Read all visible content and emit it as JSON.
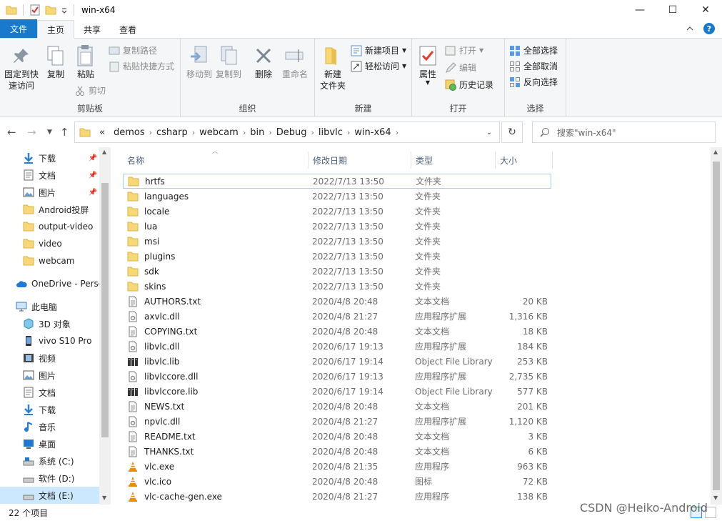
{
  "window": {
    "title": "win-x64",
    "minimize": "—",
    "maximize": "☐",
    "close": "✕"
  },
  "ribbon_tabs": [
    "文件",
    "主页",
    "共享",
    "查看"
  ],
  "ribbon": {
    "clipboard": {
      "label": "剪贴板",
      "pin": "固定到快速访问",
      "pin_l1": "固定到快",
      "pin_l2": "速访问",
      "copy": "复制",
      "paste": "粘贴",
      "copy_path": "复制路径",
      "paste_shortcut": "粘贴快捷方式",
      "cut": "剪切"
    },
    "organize": {
      "label": "组织",
      "move_to": "移动到",
      "copy_to": "复制到",
      "delete": "删除",
      "rename": "重命名"
    },
    "new": {
      "label": "新建",
      "new_folder_l1": "新建",
      "new_folder_l2": "文件夹",
      "new_item": "新建项目",
      "easy_access": "轻松访问"
    },
    "open": {
      "label": "打开",
      "properties": "属性",
      "open": "打开",
      "edit": "编辑",
      "history": "历史记录"
    },
    "select": {
      "label": "选择",
      "select_all": "全部选择",
      "select_none": "全部取消",
      "invert": "反向选择"
    }
  },
  "address": {
    "crumbs": [
      "«",
      "demos",
      "csharp",
      "webcam",
      "bin",
      "Debug",
      "libvlc",
      "win-x64"
    ],
    "search_placeholder": "搜索\"win-x64\""
  },
  "nav": [
    {
      "label": "下载",
      "icon": "download-icon",
      "pinned": true
    },
    {
      "label": "文档",
      "icon": "document-icon",
      "pinned": true
    },
    {
      "label": "图片",
      "icon": "picture-icon",
      "pinned": true
    },
    {
      "label": "Android投屏",
      "icon": "folder-icon"
    },
    {
      "label": "output-video",
      "icon": "folder-icon"
    },
    {
      "label": "video",
      "icon": "folder-icon"
    },
    {
      "label": "webcam",
      "icon": "folder-icon"
    },
    {
      "label": "OneDrive - Perso",
      "icon": "cloud-icon"
    },
    {
      "label": "此电脑",
      "icon": "computer-icon"
    },
    {
      "label": "3D 对象",
      "icon": "3d-objects-icon"
    },
    {
      "label": "vivo S10 Pro",
      "icon": "phone-icon"
    },
    {
      "label": "视频",
      "icon": "video-icon"
    },
    {
      "label": "图片",
      "icon": "picture-icon"
    },
    {
      "label": "文档",
      "icon": "document-icon"
    },
    {
      "label": "下载",
      "icon": "download-icon"
    },
    {
      "label": "音乐",
      "icon": "music-icon"
    },
    {
      "label": "桌面",
      "icon": "desktop-icon"
    },
    {
      "label": "系统 (C:)",
      "icon": "drive-icon"
    },
    {
      "label": "软件 (D:)",
      "icon": "drive-icon"
    },
    {
      "label": "文档 (E:)",
      "icon": "drive-icon",
      "selected": true
    }
  ],
  "columns": {
    "name": "名称",
    "date": "修改日期",
    "type": "类型",
    "size": "大小"
  },
  "files": [
    {
      "name": "hrtfs",
      "date": "2022/7/13 13:50",
      "type": "文件夹",
      "size": "",
      "icon": "folder-icon"
    },
    {
      "name": "languages",
      "date": "2022/7/13 13:50",
      "type": "文件夹",
      "size": "",
      "icon": "folder-icon"
    },
    {
      "name": "locale",
      "date": "2022/7/13 13:50",
      "type": "文件夹",
      "size": "",
      "icon": "folder-icon"
    },
    {
      "name": "lua",
      "date": "2022/7/13 13:50",
      "type": "文件夹",
      "size": "",
      "icon": "folder-icon"
    },
    {
      "name": "msi",
      "date": "2022/7/13 13:50",
      "type": "文件夹",
      "size": "",
      "icon": "folder-icon"
    },
    {
      "name": "plugins",
      "date": "2022/7/13 13:50",
      "type": "文件夹",
      "size": "",
      "icon": "folder-icon"
    },
    {
      "name": "sdk",
      "date": "2022/7/13 13:50",
      "type": "文件夹",
      "size": "",
      "icon": "folder-icon"
    },
    {
      "name": "skins",
      "date": "2022/7/13 13:50",
      "type": "文件夹",
      "size": "",
      "icon": "folder-icon"
    },
    {
      "name": "AUTHORS.txt",
      "date": "2020/4/8 20:48",
      "type": "文本文档",
      "size": "20 KB",
      "icon": "text-file-icon"
    },
    {
      "name": "axvlc.dll",
      "date": "2020/4/8 21:27",
      "type": "应用程序扩展",
      "size": "1,316 KB",
      "icon": "dll-icon"
    },
    {
      "name": "COPYING.txt",
      "date": "2020/4/8 20:48",
      "type": "文本文档",
      "size": "18 KB",
      "icon": "text-file-icon"
    },
    {
      "name": "libvlc.dll",
      "date": "2020/6/17 19:13",
      "type": "应用程序扩展",
      "size": "184 KB",
      "icon": "dll-icon"
    },
    {
      "name": "libvlc.lib",
      "date": "2020/6/17 19:14",
      "type": "Object File Library",
      "size": "253 KB",
      "icon": "lib-icon"
    },
    {
      "name": "libvlccore.dll",
      "date": "2020/6/17 19:13",
      "type": "应用程序扩展",
      "size": "2,735 KB",
      "icon": "dll-icon"
    },
    {
      "name": "libvlccore.lib",
      "date": "2020/6/17 19:14",
      "type": "Object File Library",
      "size": "577 KB",
      "icon": "lib-icon"
    },
    {
      "name": "NEWS.txt",
      "date": "2020/4/8 20:48",
      "type": "文本文档",
      "size": "201 KB",
      "icon": "text-file-icon"
    },
    {
      "name": "npvlc.dll",
      "date": "2020/4/8 21:27",
      "type": "应用程序扩展",
      "size": "1,120 KB",
      "icon": "dll-icon"
    },
    {
      "name": "README.txt",
      "date": "2020/4/8 20:48",
      "type": "文本文档",
      "size": "3 KB",
      "icon": "text-file-icon"
    },
    {
      "name": "THANKS.txt",
      "date": "2020/4/8 20:48",
      "type": "文本文档",
      "size": "6 KB",
      "icon": "text-file-icon"
    },
    {
      "name": "vlc.exe",
      "date": "2020/4/8 21:35",
      "type": "应用程序",
      "size": "963 KB",
      "icon": "vlc-cone-icon"
    },
    {
      "name": "vlc.ico",
      "date": "2020/4/8 20:48",
      "type": "图标",
      "size": "72 KB",
      "icon": "vlc-cone-icon"
    },
    {
      "name": "vlc-cache-gen.exe",
      "date": "2020/4/8 21:27",
      "type": "应用程序",
      "size": "138 KB",
      "icon": "vlc-cone-icon"
    }
  ],
  "status": {
    "count": "22 个项目"
  },
  "watermark": "CSDN @Heiko-Android",
  "colors": {
    "accent": "#1979ca",
    "folder": "#f8d775",
    "selection": "#cce8ff",
    "vlc_orange": "#f08a00"
  }
}
